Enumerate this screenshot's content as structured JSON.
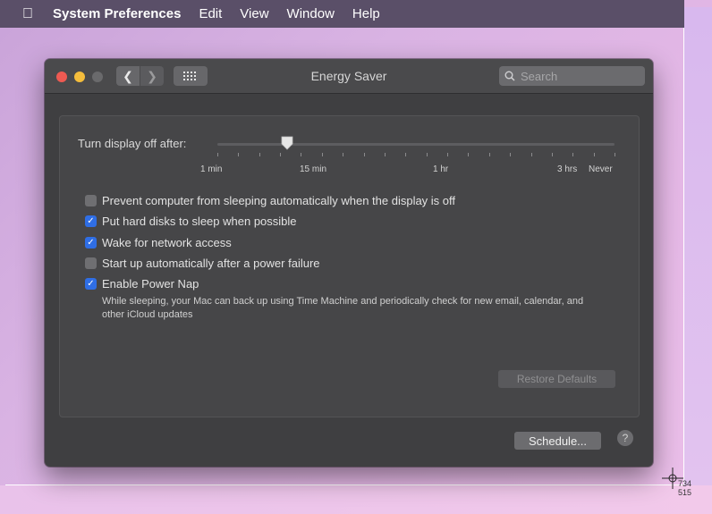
{
  "menubar": {
    "apple_icon": "apple-icon",
    "app_name": "System Preferences",
    "items": [
      "Edit",
      "View",
      "Window",
      "Help"
    ]
  },
  "window": {
    "title": "Energy Saver",
    "back_icon": "chevron-left-icon",
    "forward_icon": "chevron-right-icon",
    "grid_icon": "grid-icon",
    "search_placeholder": "Search"
  },
  "display": {
    "label": "Turn display off after:",
    "slider_value": "15 min",
    "tick_labels": [
      "1 min",
      "15 min",
      "1 hr",
      "3 hrs",
      "Never"
    ]
  },
  "options": [
    {
      "label": "Prevent computer from sleeping automatically when the display is off",
      "checked": false
    },
    {
      "label": "Put hard disks to sleep when possible",
      "checked": true
    },
    {
      "label": "Wake for network access",
      "checked": true
    },
    {
      "label": "Start up automatically after a power failure",
      "checked": false
    },
    {
      "label": "Enable Power Nap",
      "checked": true
    }
  ],
  "power_nap_description": "While sleeping, your Mac can back up using Time Machine and periodically check for new email, calendar, and other iCloud updates",
  "buttons": {
    "restore_defaults": "Restore Defaults",
    "schedule": "Schedule...",
    "help": "?"
  },
  "cursor": {
    "readout_x": "734",
    "readout_y": "515"
  },
  "colors": {
    "accent": "#2f6ee5",
    "window_bg": "#3f3f41",
    "close": "#ee5a52",
    "minimize": "#f4bd3c"
  }
}
